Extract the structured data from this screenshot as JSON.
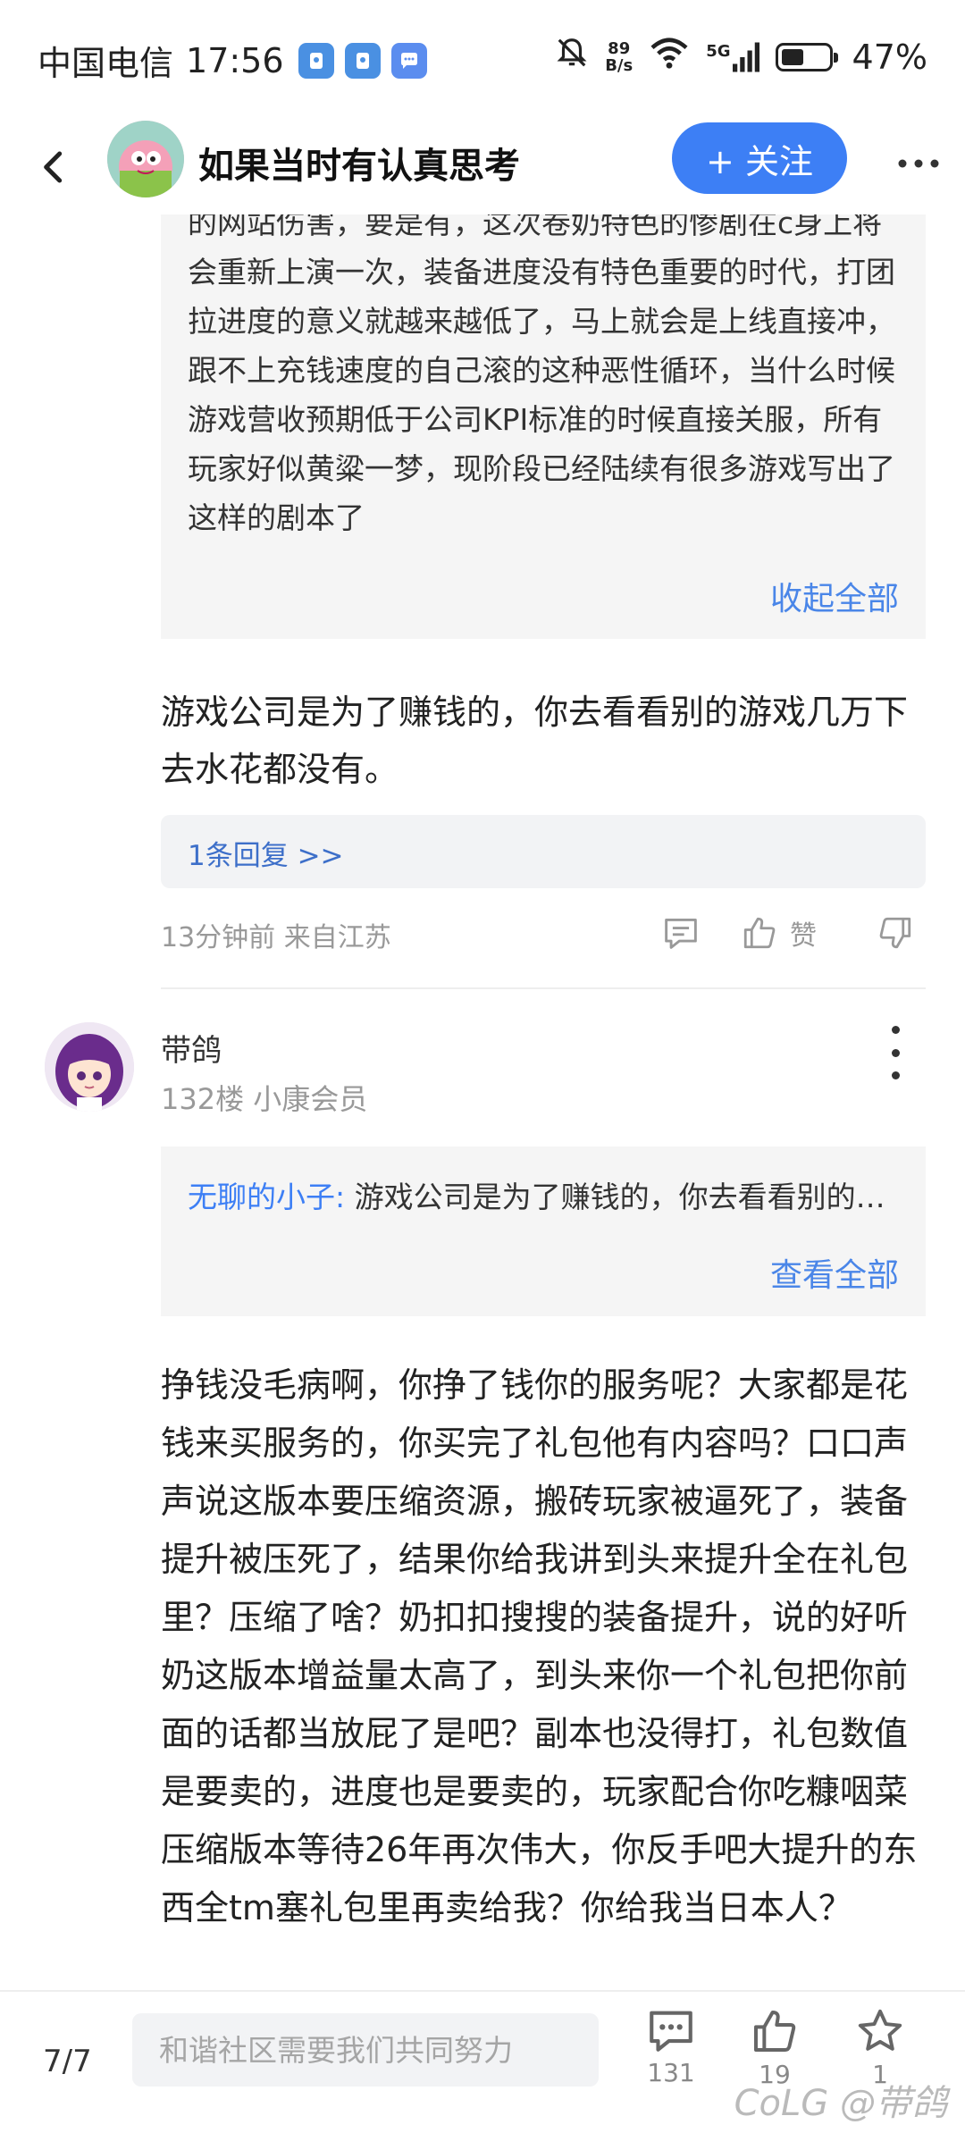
{
  "status_bar": {
    "carrier": "中国电信",
    "time": "17:56",
    "net_speed_value": "89",
    "net_speed_unit": "B/s",
    "network": "5G",
    "battery": "47%"
  },
  "header": {
    "title": "如果当时有认真思考",
    "follow_label": "+ 关注"
  },
  "quoted_reply": {
    "text": "的网站伤害，要是有，这次卷奶特色的惨剧在c身上将会重新上演一次，装备进度没有特色重要的时代，打团拉进度的意义就越来越低了，马上就会是上线直接冲，跟不上充钱速度的自己滚的这种恶性循环，当什么时候游戏营收预期低于公司KPI标准的时候直接关服，所有玩家好似黄粱一梦，现阶段已经陆续有很多游戏写出了这样的剧本了",
    "collapse_label": "收起全部"
  },
  "first_reply": {
    "text": "游戏公司是为了赚钱的，你去看看别的游戏几万下去水花都没有。",
    "replies_link": "1条回复 >>",
    "meta": "13分钟前 来自江苏",
    "like_label": "赞"
  },
  "second_comment": {
    "user_name": "带鸽",
    "floor_info": "132楼 小康会员",
    "quote_author": "无聊的小子:",
    "quote_text": " 游戏公司是为了赚钱的，你去看看别的游戏几万下去水花都没有。",
    "view_all_label": "查看全部",
    "body": "挣钱没毛病啊，你挣了钱你的服务呢？大家都是花钱来买服务的，你买完了礼包他有内容吗？口口声声说这版本要压缩资源，搬砖玩家被逼死了，装备提升被压死了，结果你给我讲到头来提升全在礼包里？压缩了啥？奶扣扣搜搜的装备提升，说的好听奶这版本增益量太高了，到头来你一个礼包把你前面的话都当放屁了是吧？副本也没得打，礼包数值是要卖的，进度也是要卖的，玩家配合你吃糠咽菜压缩版本等待26年再次伟大，你反手吧大提升的东西全tm塞礼包里再卖给我？你给我当日本人？"
  },
  "bottom_bar": {
    "page": "7/7",
    "input_placeholder": "和谐社区需要我们共同努力",
    "comment_count": "131",
    "like_count": "19",
    "fav_count": "1",
    "watermark": "CoLG @带鸽"
  },
  "colors": {
    "accent": "#3d7ff5",
    "link": "#4a86e8"
  }
}
